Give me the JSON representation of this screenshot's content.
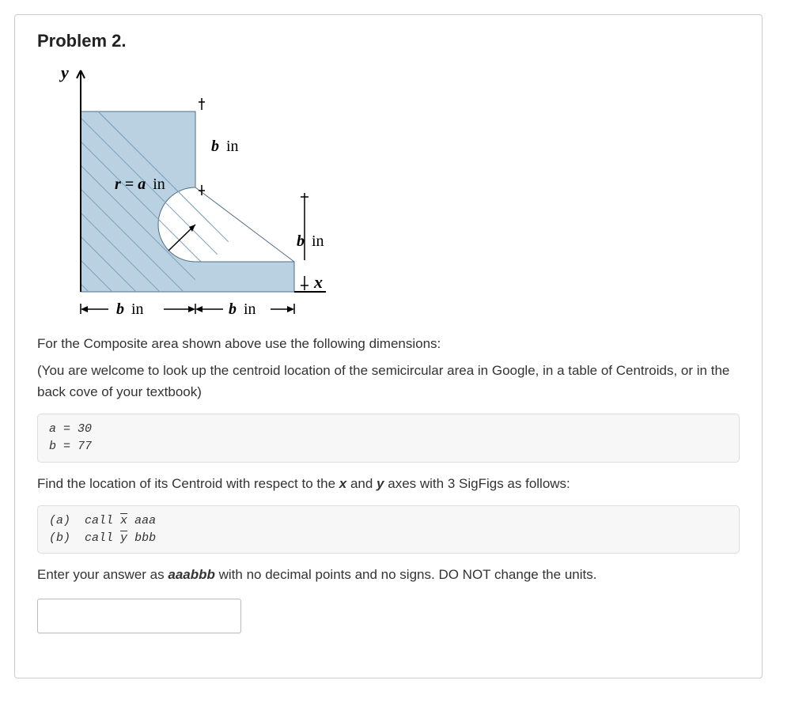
{
  "problem": {
    "title": "Problem 2.",
    "figure": {
      "y_label": "y",
      "x_label": "x",
      "dim_b_top": "b",
      "dim_b_top_unit": "in",
      "dim_r_eq": "r = ",
      "dim_a": "a",
      "dim_a_unit": "in",
      "dim_b_right": "b",
      "dim_b_right_unit": "in",
      "dim_b_bottom_left": "b",
      "dim_b_bottom_left_unit": "in",
      "dim_b_bottom_right": "b",
      "dim_b_bottom_right_unit": "in"
    },
    "intro": "For the Composite area shown above use the following dimensions:",
    "note": "(You are welcome to look up the centroid location of the semicircular area in Google, in a table of Centroids, or in the back cove of your textbook)",
    "given": {
      "line1": "a = 30",
      "line2": "b = 77"
    },
    "task_prefix": "Find the location of its Centroid with respect to the ",
    "task_x": "x",
    "task_mid": " and ",
    "task_y": "y",
    "task_suffix": " axes with 3 SigFigs as follows:",
    "answers_box": {
      "a_label": "(a)",
      "a_text_pre": "call ",
      "a_var": "x",
      "a_text_post": " aaa",
      "b_label": "(b)",
      "b_text_pre": "call ",
      "b_var": "y",
      "b_text_post": " bbb"
    },
    "submit_prefix": "Enter your answer as ",
    "submit_bold": "aaabbb",
    "submit_suffix": " with no decimal points and no signs. DO NOT change the units.",
    "input_value": ""
  }
}
